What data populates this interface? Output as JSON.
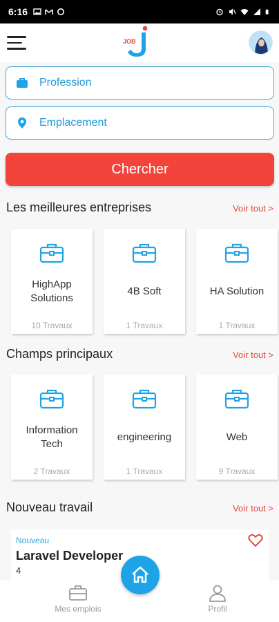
{
  "status_bar": {
    "time": "6:16",
    "left_icons": [
      "gallery-icon",
      "gmail-icon",
      "circle-icon"
    ],
    "right_icons": [
      "alarm-icon",
      "mute-icon",
      "wifi-icon",
      "signal-icon",
      "battery-icon"
    ]
  },
  "header": {
    "logo_text": "JOB",
    "menu_icon": "hamburger-icon",
    "avatar": "user-avatar"
  },
  "search": {
    "profession_placeholder": "Profession",
    "location_placeholder": "Emplacement",
    "button_label": "Chercher"
  },
  "companies": {
    "title": "Les meilleures entreprises",
    "see_all": "Voir tout >",
    "items": [
      {
        "name": "HighApp Solutions",
        "count": "10 Travaux"
      },
      {
        "name": "4B Soft",
        "count": "1 Travaux"
      },
      {
        "name": "HA Solution",
        "count": "1 Travaux"
      }
    ]
  },
  "fields": {
    "title": "Champs principaux",
    "see_all": "Voir tout >",
    "items": [
      {
        "name": "Information Tech",
        "count": "2 Travaux"
      },
      {
        "name": "engineering",
        "count": "1 Travaux"
      },
      {
        "name": "Web",
        "count": "9 Travaux"
      }
    ]
  },
  "new_jobs": {
    "title": "Nouveau travail",
    "see_all": "Voir tout >",
    "items": [
      {
        "badge": "Nouveau",
        "title": "Laravel Developer",
        "number": "4"
      }
    ]
  },
  "bottom_nav": {
    "my_jobs": "Mes emplois",
    "profile": "Profil",
    "home_icon": "home-icon"
  },
  "colors": {
    "accent_blue": "#1ea4e6",
    "button_red": "#f2443a",
    "link_red": "#e8483e"
  }
}
